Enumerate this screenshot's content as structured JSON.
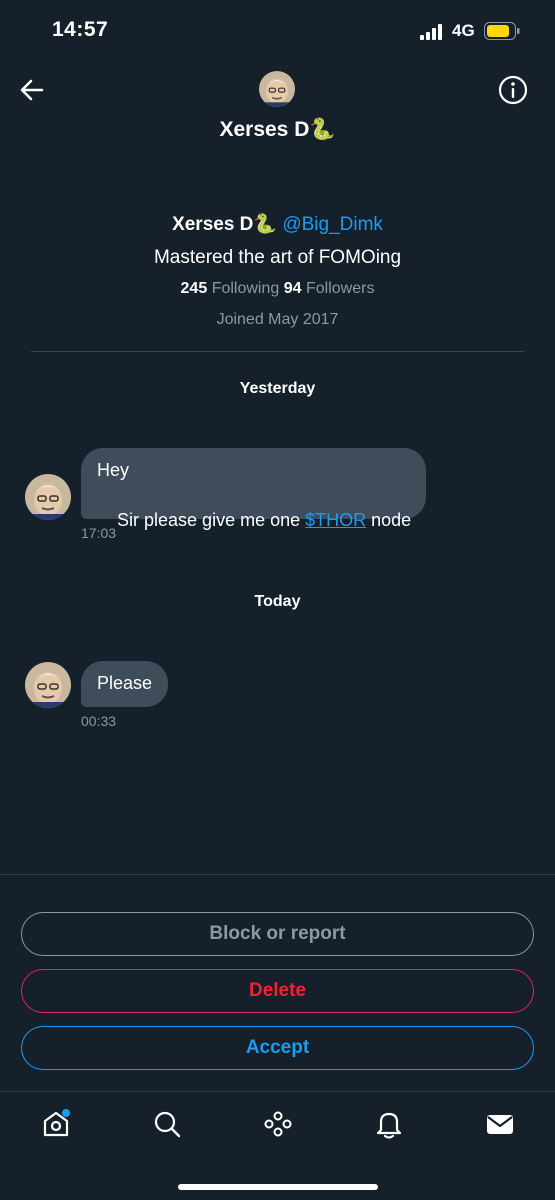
{
  "status_bar": {
    "time": "14:57",
    "network": "4G"
  },
  "header": {
    "name": "Xerses D🐍"
  },
  "profile": {
    "name": "Xerses D🐍",
    "handle": "@Big_Dimk",
    "bio": "Mastered the art of FOMOing",
    "following_count": "245",
    "following_label": "Following",
    "followers_count": "94",
    "followers_label": "Followers",
    "joined": "Joined May 2017"
  },
  "conversation": [
    {
      "day": "Yesterday",
      "message": {
        "line1": "Hey",
        "line2_prefix": "Sir please give me one ",
        "line2_link": "$THOR",
        "line2_suffix": " node",
        "time": "17:03"
      }
    },
    {
      "day": "Today",
      "message": {
        "text": "Please",
        "time": "00:33"
      }
    }
  ],
  "actions": {
    "block": "Block or report",
    "delete": "Delete",
    "accept": "Accept"
  },
  "nav": [
    "home-icon",
    "search-icon",
    "spaces-icon",
    "notifications-icon",
    "messages-icon"
  ],
  "colors": {
    "background": "#15202b",
    "accent": "#1d9bf0",
    "danger": "#f4212e",
    "bubble": "#3f4d5b"
  }
}
